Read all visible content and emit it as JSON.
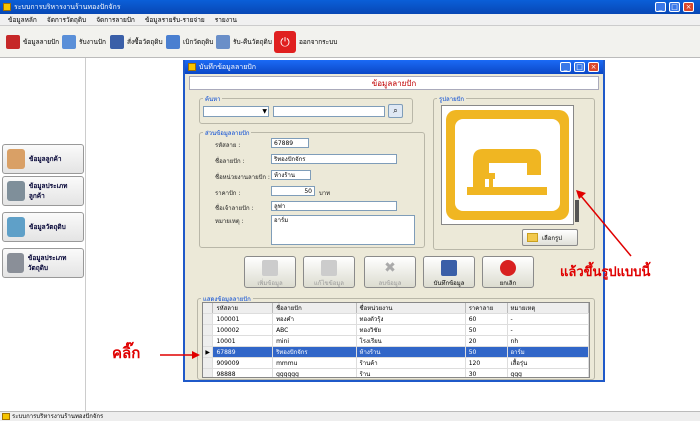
{
  "app": {
    "title": "ระบบการบริหารงานร้านทองปักจักร",
    "minimize": "_",
    "maximize": "□",
    "close": "×"
  },
  "menu": [
    "ข้อมูลหลัก",
    "จัดการวัตถุดิบ",
    "จัดการลายปัก",
    "ข้อมูลรายรับ-รายจ่าย",
    "รายงาน"
  ],
  "toolbar": [
    "ข้อมูลลายปัก",
    "รับงานปัก",
    "สั่งซื้อวัตถุดิบ",
    "เบิกวัตถุดิบ",
    "รับ-คืนวัตถุดิบ",
    "ออกจากระบบ"
  ],
  "sidebar": [
    "ข้อมูลลูกค้า",
    "ข้อมูลประเภทลูกค้า",
    "ข้อมูลวัตถุดิบ",
    "ข้อมูลประเภทวัตถุดิบ"
  ],
  "status": "ระบบการบริหารงานร้านทองปักจักร",
  "dialog": {
    "title": "บันทึกข้อมูลลายปัก",
    "header": "ข้อมูลลายปัก",
    "search_group": "ค้นหา",
    "detail_group": "ส่วนข้อมูลลายปัก",
    "image_group": "รูปลายปัก",
    "labels": {
      "code": "รหัสลาย :",
      "name": "ชื่อลายปัก :",
      "unit": "ชื่อหน่วยงานลายปัก :",
      "price": "ราคาปัก :",
      "owner": "ชื่อเจ้าลายปัก :",
      "note": "หมายเหตุ :",
      "baht": "บาท"
    },
    "values": {
      "code": "67889",
      "name": "ริทองปักจักร",
      "unit": "ห้างร้าน",
      "price": "50",
      "owner": "ลูฟา",
      "note": "อาร์ม"
    },
    "choose_image": "เลือกรูป",
    "buttons": [
      "เพิ่มข้อมูล",
      "แก้ไขข้อมูล",
      "ลบข้อมูล",
      "บันทึกข้อมูล",
      "ยกเลิก"
    ],
    "list_group": "แสดงข้อมูลลายปัก",
    "table": {
      "headers": [
        "รหัสลาย",
        "ชื่อลายปัก",
        "ชื่อหน่วยงาน",
        "ราคาลาย",
        "หมายเหตุ"
      ],
      "rows": [
        [
          "100001",
          "ทองคำ",
          "ทองตัวรุ้ง",
          "60",
          "-"
        ],
        [
          "100002",
          "ABC",
          "ทองวิชัย",
          "50",
          "-"
        ],
        [
          "10001",
          "mini",
          "โรงเรียน",
          "20",
          "nh"
        ],
        [
          "67889",
          "ริทองปักจักร",
          "ห้างร้าน",
          "50",
          "อาร์ม"
        ],
        [
          "909009",
          "mmmu",
          "ร้านค้า",
          "120",
          "เสื้อรุ่น"
        ],
        [
          "98888",
          "gggggg",
          "ร้าน",
          "30",
          "ggg"
        ]
      ],
      "selected_row": 3
    }
  },
  "annotations": {
    "click": "คลิ๊ก",
    "image_note": "แล้วขึ้นรูปแบบนี้"
  },
  "colors": {
    "accent": "#1f59c9",
    "selected_row": "#3166c8",
    "annotation": "#e00000",
    "machine_icon": "#f0b622"
  }
}
